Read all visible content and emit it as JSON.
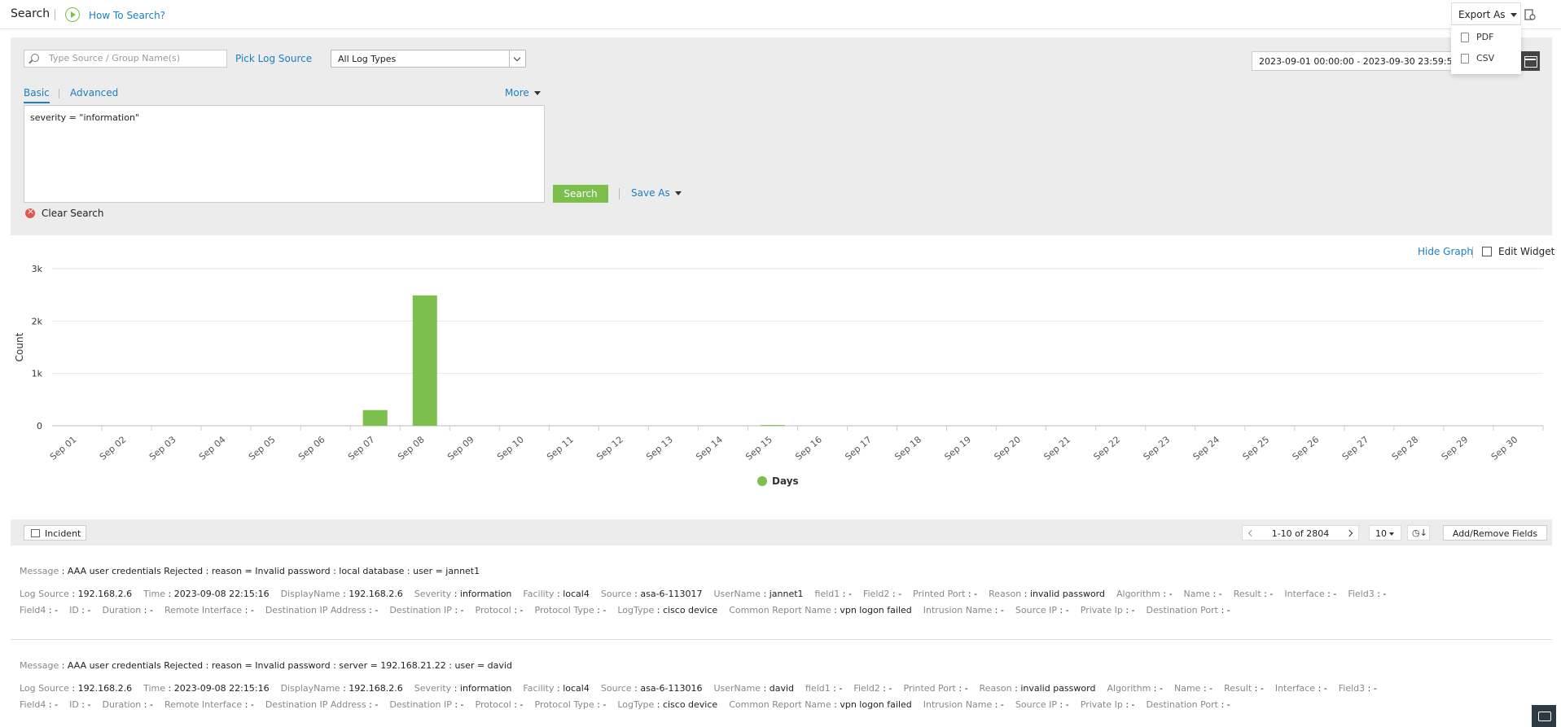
{
  "header": {
    "title": "Search",
    "howto_label": "How To Search?",
    "export_label": "Export As",
    "export_options": [
      "PDF",
      "CSV"
    ]
  },
  "search": {
    "source_placeholder": "Type Source / Group Name(s)",
    "pick_source_label": "Pick Log Source",
    "log_type_selected": "All Log Types",
    "date_range": "2023-09-01 00:00:00 - 2023-09-30 23:59:59",
    "tabs": [
      "Basic",
      "Advanced"
    ],
    "more_label": "More",
    "query": "severity = \"information\"",
    "search_button": "Search",
    "save_as_label": "Save As",
    "clear_label": "Clear Search"
  },
  "graph": {
    "hide_label": "Hide Graph",
    "edit_label": "Edit Widget"
  },
  "chart_data": {
    "type": "bar",
    "title": "",
    "xlabel": "",
    "ylabel": "Count",
    "ylim": [
      0,
      3000
    ],
    "yticks": [
      "0",
      "1k",
      "2k",
      "3k"
    ],
    "categories": [
      "Sep 01",
      "Sep 02",
      "Sep 03",
      "Sep 04",
      "Sep 05",
      "Sep 06",
      "Sep 07",
      "Sep 08",
      "Sep 09",
      "Sep 10",
      "Sep 11",
      "Sep 12",
      "Sep 13",
      "Sep 14",
      "Sep 15",
      "Sep 16",
      "Sep 17",
      "Sep 18",
      "Sep 19",
      "Sep 20",
      "Sep 21",
      "Sep 22",
      "Sep 23",
      "Sep 24",
      "Sep 25",
      "Sep 26",
      "Sep 27",
      "Sep 28",
      "Sep 29",
      "Sep 30"
    ],
    "series": [
      {
        "name": "Days",
        "color": "#7cbf4d",
        "values": [
          0,
          0,
          0,
          0,
          0,
          0,
          300,
          2490,
          0,
          0,
          0,
          0,
          0,
          0,
          14,
          0,
          0,
          0,
          0,
          0,
          0,
          0,
          0,
          0,
          0,
          0,
          0,
          0,
          0,
          0
        ]
      }
    ],
    "grid": true,
    "legend": "bottom-center"
  },
  "results": {
    "incident_label": "Incident",
    "pager_text": "1-10 of 2804",
    "per_page": "10",
    "add_remove_label": "Add/Remove Fields",
    "entries": [
      {
        "message": "AAA user credentials Rejected : reason = Invalid password : local database : user = jannet1",
        "line1": [
          [
            "Log Source",
            "192.168.2.6"
          ],
          [
            "Time",
            "2023-09-08 22:15:16"
          ],
          [
            "DisplayName",
            "192.168.2.6"
          ],
          [
            "Severity",
            "information"
          ],
          [
            "Facility",
            "local4"
          ],
          [
            "Source",
            "asa-6-113017"
          ],
          [
            "UserName",
            "jannet1"
          ],
          [
            "field1",
            "-"
          ],
          [
            "Field2",
            "-"
          ],
          [
            "Printed Port",
            "-"
          ],
          [
            "Reason",
            "invalid password"
          ],
          [
            "Algorithm",
            "-"
          ],
          [
            "Name",
            "-"
          ],
          [
            "Result",
            "-"
          ],
          [
            "Interface",
            "-"
          ],
          [
            "Field3",
            "-"
          ]
        ],
        "line2": [
          [
            "Field4",
            "-"
          ],
          [
            "ID",
            "-"
          ],
          [
            "Duration",
            "-"
          ],
          [
            "Remote Interface",
            "-"
          ],
          [
            "Destination IP Address",
            "-"
          ],
          [
            "Destination IP",
            "-"
          ],
          [
            "Protocol",
            "-"
          ],
          [
            "Protocol Type",
            "-"
          ],
          [
            "LogType",
            "cisco device"
          ],
          [
            "Common Report Name",
            "vpn logon failed"
          ],
          [
            "Intrusion Name",
            "-"
          ],
          [
            "Source IP",
            "-"
          ],
          [
            "Private Ip",
            "-"
          ],
          [
            "Destination Port",
            "-"
          ]
        ]
      },
      {
        "message": "AAA user credentials Rejected : reason = Invalid password : server = 192.168.21.22 : user = david",
        "line1": [
          [
            "Log Source",
            "192.168.2.6"
          ],
          [
            "Time",
            "2023-09-08 22:15:16"
          ],
          [
            "DisplayName",
            "192.168.2.6"
          ],
          [
            "Severity",
            "information"
          ],
          [
            "Facility",
            "local4"
          ],
          [
            "Source",
            "asa-6-113016"
          ],
          [
            "UserName",
            "david"
          ],
          [
            "field1",
            "-"
          ],
          [
            "Field2",
            "-"
          ],
          [
            "Printed Port",
            "-"
          ],
          [
            "Reason",
            "invalid password"
          ],
          [
            "Algorithm",
            "-"
          ],
          [
            "Name",
            "-"
          ],
          [
            "Result",
            "-"
          ],
          [
            "Interface",
            "-"
          ],
          [
            "Field3",
            "-"
          ]
        ],
        "line2": [
          [
            "Field4",
            "-"
          ],
          [
            "ID",
            "-"
          ],
          [
            "Duration",
            "-"
          ],
          [
            "Remote Interface",
            "-"
          ],
          [
            "Destination IP Address",
            "-"
          ],
          [
            "Destination IP",
            "-"
          ],
          [
            "Protocol",
            "-"
          ],
          [
            "Protocol Type",
            "-"
          ],
          [
            "LogType",
            "cisco device"
          ],
          [
            "Common Report Name",
            "vpn logon failed"
          ],
          [
            "Intrusion Name",
            "-"
          ],
          [
            "Source IP",
            "-"
          ],
          [
            "Private Ip",
            "-"
          ],
          [
            "Destination Port",
            "-"
          ]
        ]
      }
    ]
  },
  "icons": {
    "howto": "play-circle-icon",
    "export_side": "export-file-icon",
    "pdf": "pdf-file-icon",
    "csv": "csv-file-icon",
    "search": "search-icon",
    "calendar": "calendar-icon",
    "clear": "close-circle-icon",
    "edit_widget": "edit-widget-icon",
    "incident": "incident-icon",
    "chat": "chat-icon"
  }
}
